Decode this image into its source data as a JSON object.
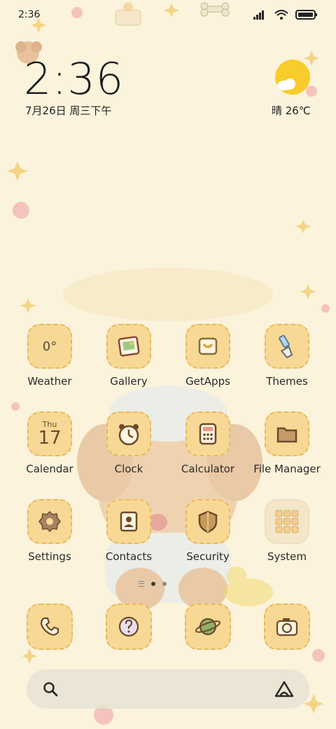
{
  "status_bar": {
    "time": "2:36"
  },
  "clock_widget": {
    "time": "2:36",
    "date": "7月26日 周三下午"
  },
  "weather_widget": {
    "condition_temp": "晴 26℃"
  },
  "apps": [
    {
      "label": "Weather",
      "value": "0°"
    },
    {
      "label": "Gallery"
    },
    {
      "label": "GetApps"
    },
    {
      "label": "Themes"
    },
    {
      "label": "Calendar",
      "day": "Thu",
      "date": "17"
    },
    {
      "label": "Clock"
    },
    {
      "label": "Calculator"
    },
    {
      "label": "File Manager"
    },
    {
      "label": "Settings"
    },
    {
      "label": "Contacts"
    },
    {
      "label": "Security"
    },
    {
      "label": "System"
    }
  ],
  "dock": [
    {
      "icon": "phone-icon"
    },
    {
      "icon": "help-icon"
    },
    {
      "icon": "browser-icon"
    },
    {
      "icon": "camera-icon"
    }
  ],
  "colors": {
    "tile": "#f7d995",
    "tile_border": "#e7b95f",
    "background": "#fbf3dc",
    "icon_brown": "#6d4a2a"
  }
}
